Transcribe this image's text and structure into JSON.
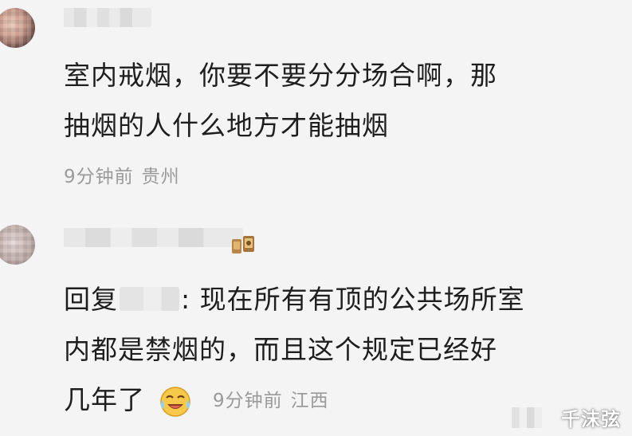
{
  "comments": [
    {
      "body_lines": [
        "室内戒烟，你要不要分分场合啊，那",
        "抽烟的人什么地方才能抽烟"
      ],
      "time": "9分钟前",
      "location": "贵州"
    },
    {
      "reply_prefix": "回复",
      "reply_suffix": ":",
      "body_first": "现在所有有顶的公共场所室",
      "body_lines": [
        "内都是禁烟的，而且这个规定已经好",
        "几年了"
      ],
      "emoji": "crying-laughing-emoji",
      "time": "9分钟前",
      "location": "江西"
    }
  ],
  "watermark": "千沫弦",
  "colors": {
    "background": "#f4f4f4",
    "text": "#1e1e1e",
    "meta": "#9a9a9a"
  },
  "icons": {
    "medal": "medal-badge-icon",
    "emoji": "crying-laughing-emoji"
  }
}
